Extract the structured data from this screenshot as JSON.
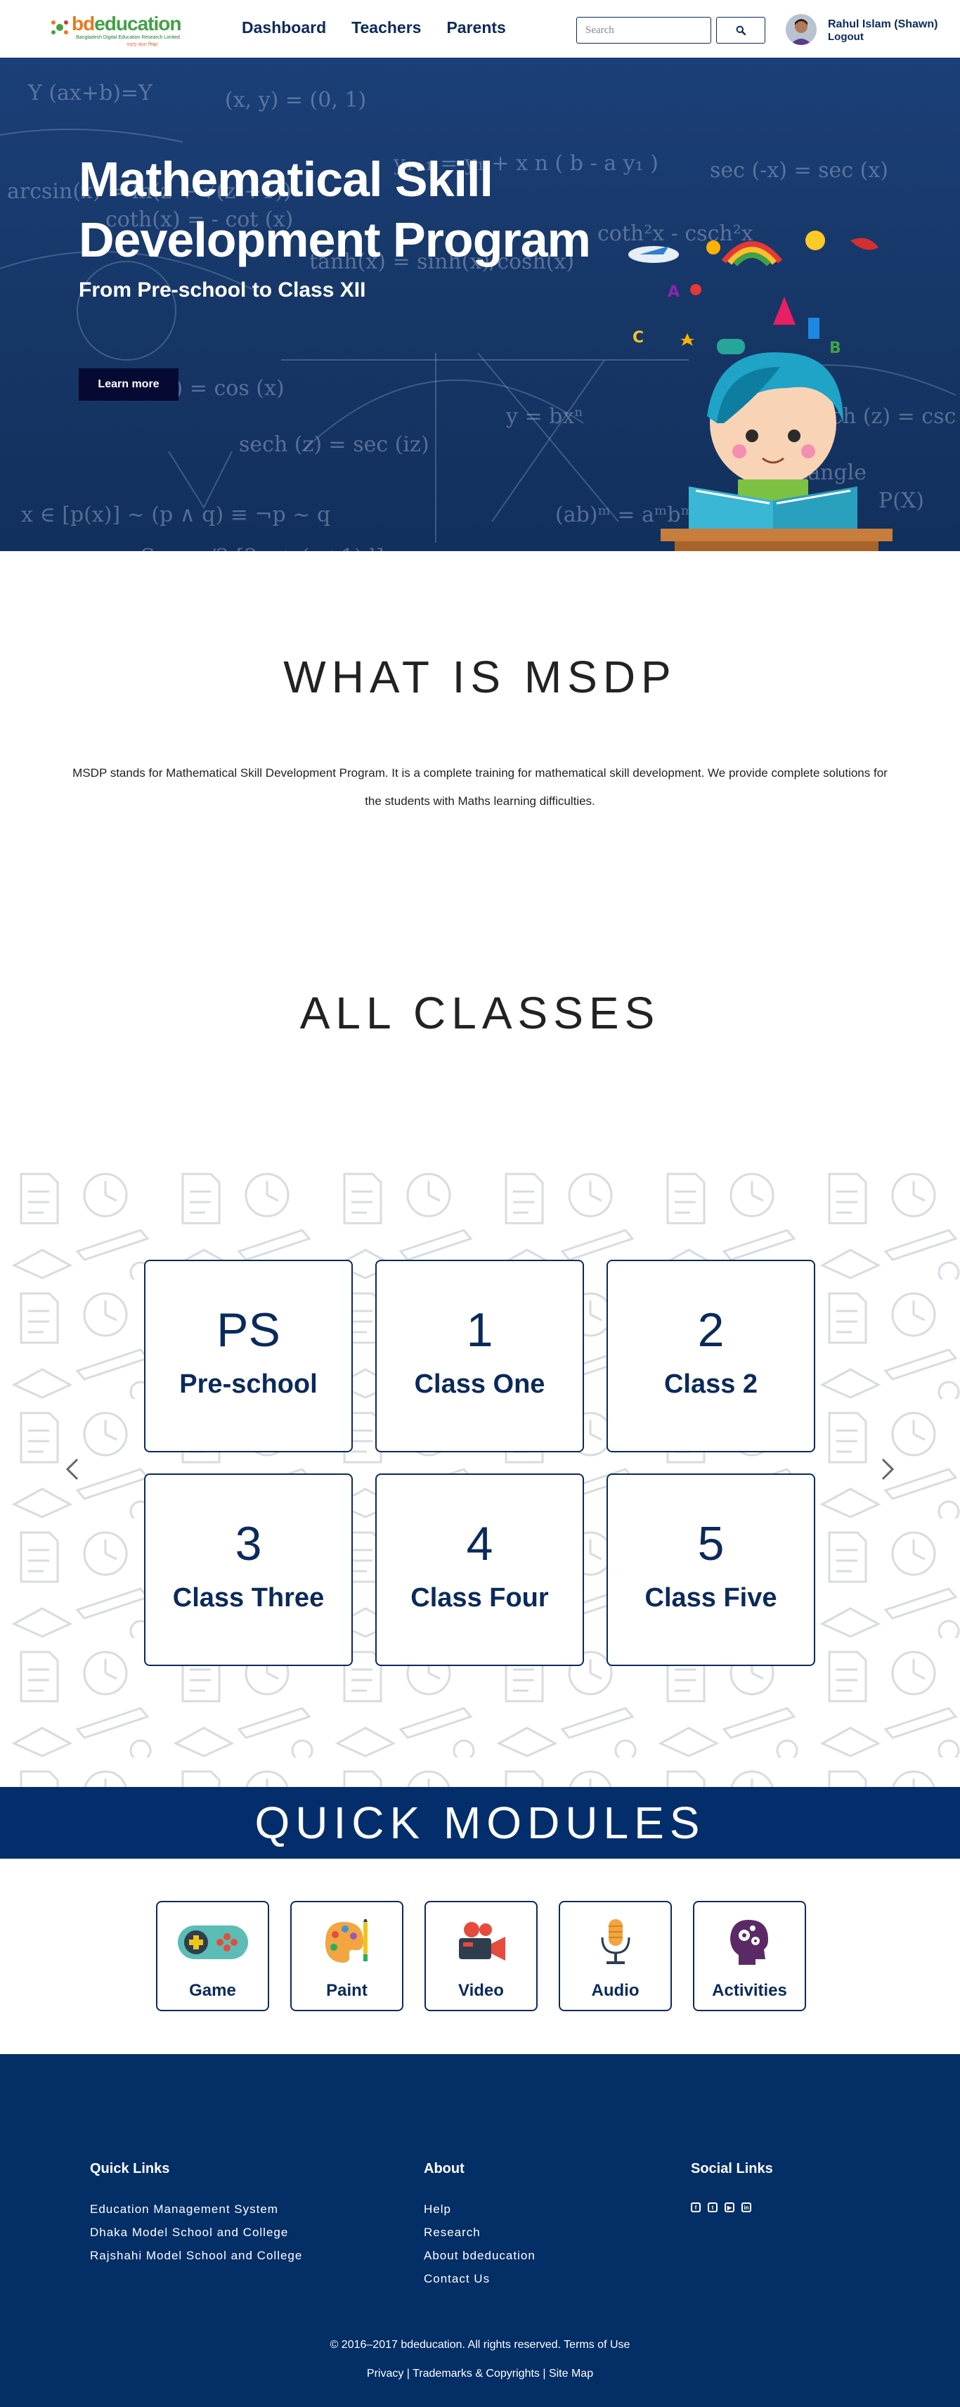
{
  "brand": {
    "logo_text_a": "bd",
    "logo_text_b": "education",
    "logo_sub": "Bangladesh Digital Education Research Limited",
    "logo_sub2": "সবার জন্য শিক্ষা"
  },
  "nav": {
    "links": [
      "Dashboard",
      "Teachers",
      "Parents"
    ],
    "search_placeholder": "Search",
    "user_name": "Rahul Islam (Shawn)",
    "logout_label": "Logout"
  },
  "hero": {
    "title": "Mathematical Skill Development Program",
    "subtitle": "From Pre-school to Class XII",
    "button_label": "Learn more"
  },
  "what": {
    "title": "WHAT IS MSDP",
    "description": "MSDP stands for Mathematical Skill Development Program. It is a complete training for mathematical skill development. We provide complete solutions for the students with Maths learning difficulties."
  },
  "classes": {
    "title": "ALL CLASSES",
    "items": [
      {
        "code": "PS",
        "name": "Pre-school"
      },
      {
        "code": "1",
        "name": "Class One"
      },
      {
        "code": "2",
        "name": "Class 2"
      },
      {
        "code": "3",
        "name": "Class Three"
      },
      {
        "code": "4",
        "name": "Class Four"
      },
      {
        "code": "5",
        "name": "Class Five"
      }
    ]
  },
  "modules": {
    "title": "QUICK MODULES",
    "items": [
      {
        "label": "Game",
        "icon": "gamepad-icon"
      },
      {
        "label": "Paint",
        "icon": "palette-icon"
      },
      {
        "label": "Video",
        "icon": "video-camera-icon"
      },
      {
        "label": "Audio",
        "icon": "microphone-icon"
      },
      {
        "label": "Activities",
        "icon": "head-gears-icon"
      }
    ]
  },
  "footer": {
    "quick_links_title": "Quick Links",
    "quick_links": [
      "Education Management System",
      "Dhaka Model School and College",
      "Rajshahi Model School and College"
    ],
    "about_title": "About",
    "about_links": [
      "Help",
      "Research",
      "About bdeducation",
      "Contact Us"
    ],
    "social_title": "Social Links",
    "social_icons": [
      "facebook-icon",
      "twitter-icon",
      "youtube-icon",
      "linkedin-icon"
    ],
    "copyright": "© 2016–2017 bdeducation. All rights reserved. Terms of Use",
    "legal_privacy": "Privacy",
    "legal_trademarks": "Trademarks & Copyrights",
    "legal_sitemap": "Site Map"
  },
  "colors": {
    "navy": "#0b2a5b",
    "footer": "#032e66",
    "accent_orange": "#e8791d",
    "accent_green": "#43a047"
  }
}
